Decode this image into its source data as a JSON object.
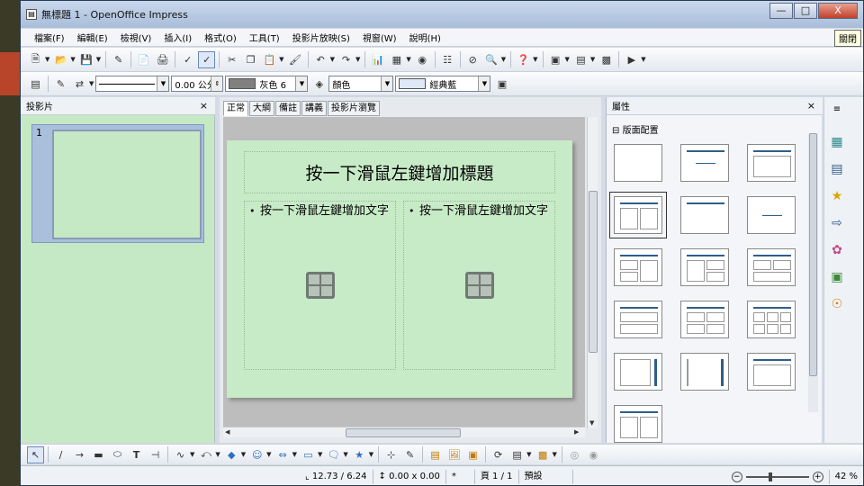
{
  "window": {
    "title": "無標題 1 - OpenOffice Impress",
    "tooltip": "關閉",
    "min_label": "—",
    "max_label": "□",
    "close_label": "X"
  },
  "menubar": [
    "檔案(F)",
    "編輯(E)",
    "檢視(V)",
    "插入(I)",
    "格式(O)",
    "工具(T)",
    "投影片放映(S)",
    "視窗(W)",
    "說明(H)"
  ],
  "toolbar2": {
    "line_width": "0.00 公分",
    "fill_color": "灰色 6",
    "area_style": "顏色",
    "area_value": "經典藍",
    "fill_swatch": "#808080",
    "area_swatch": "#dfe8f6"
  },
  "slides_panel": {
    "title": "投影片",
    "close": "×",
    "thumb_number": "1"
  },
  "view_tabs": [
    "正常",
    "大綱",
    "備註",
    "講義",
    "投影片瀏覽"
  ],
  "slide": {
    "title": "按一下滑鼠左鍵增加標題",
    "left_body": "按一下滑鼠左鍵增加文字",
    "right_body": "按一下滑鼠左鍵增加文字",
    "bullet": "•"
  },
  "properties": {
    "title": "屬性",
    "close": "×",
    "section": "版面配置",
    "section_toggle": "⊟"
  },
  "status": {
    "position": "12.73 / 6.24",
    "size": "0.00 x 0.00",
    "modified": "*",
    "page": "頁 1 / 1",
    "layout": "預設",
    "zoom": "42 %",
    "zoom_minus": "−",
    "zoom_plus": "+"
  },
  "colors": {
    "slide_bg": "#c7eac7",
    "accent": "#2f5d8a",
    "redtab": "#b8452a"
  }
}
